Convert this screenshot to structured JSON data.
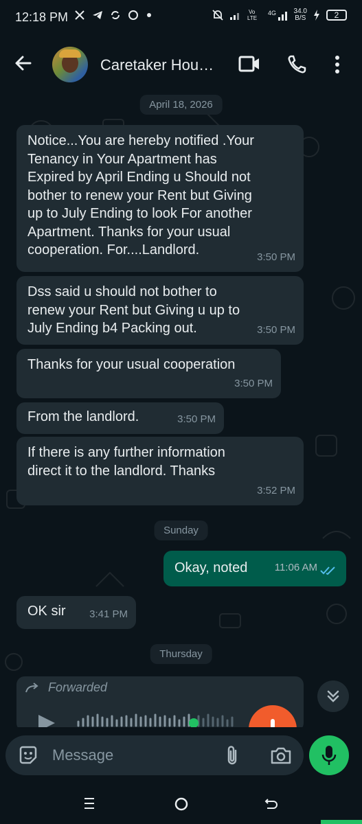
{
  "status_bar": {
    "time": "12:18 PM",
    "network_rate": "34.0",
    "network_unit": "B/S",
    "battery": "2"
  },
  "header": {
    "contact_name": "Caretaker Hou…"
  },
  "chat": {
    "date_chip_1": "April 18, 2026",
    "date_chip_2": "Sunday",
    "date_chip_3": "Thursday",
    "messages": [
      {
        "lines": [
          "Notice...You are hereby notified .Your",
          "Tenancy in Your Apartment has",
          "Expired by April Ending u Should not",
          "bother to renew your Rent but Giving",
          "up to July Ending to look For another",
          "Apartment. Thanks for your usual",
          "cooperation. For....Landlord."
        ],
        "time": "3:50 PM"
      },
      {
        "lines": [
          "Dss said u should not bother to",
          "renew your Rent but Giving u up to",
          "July Ending b4 Packing out."
        ],
        "time": "3:50 PM"
      },
      {
        "lines": [
          "Thanks for your usual cooperation"
        ],
        "time": "3:50 PM"
      },
      {
        "lines": [
          "From the landlord."
        ],
        "time": "3:50 PM"
      },
      {
        "lines": [
          "If there is any further information",
          "direct it to the landlord. Thanks"
        ],
        "time": "3:52 PM"
      },
      {
        "lines": [
          "Okay, noted"
        ],
        "time": "11:06 AM"
      },
      {
        "lines": [
          "OK sir"
        ],
        "time": "3:41 PM"
      }
    ],
    "forwarded_label": "Forwarded"
  },
  "composer": {
    "placeholder": "Message"
  },
  "colors": {
    "background": "#0b141a",
    "incoming_bubble": "#202c33",
    "outgoing_bubble": "#005c4b",
    "accent_green": "#21c063",
    "read_ticks": "#53bdeb",
    "record_orange": "#f15c2c"
  }
}
